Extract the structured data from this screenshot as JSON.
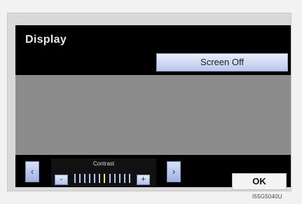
{
  "title": "Display",
  "buttons": {
    "screen_off": "Screen Off",
    "ok": "OK"
  },
  "contrast": {
    "label": "Contrast",
    "minus": "-",
    "plus": "+",
    "level": 0.5
  },
  "navigation": {
    "left": "‹",
    "right": "›"
  },
  "figure_code": "I55G5040U"
}
